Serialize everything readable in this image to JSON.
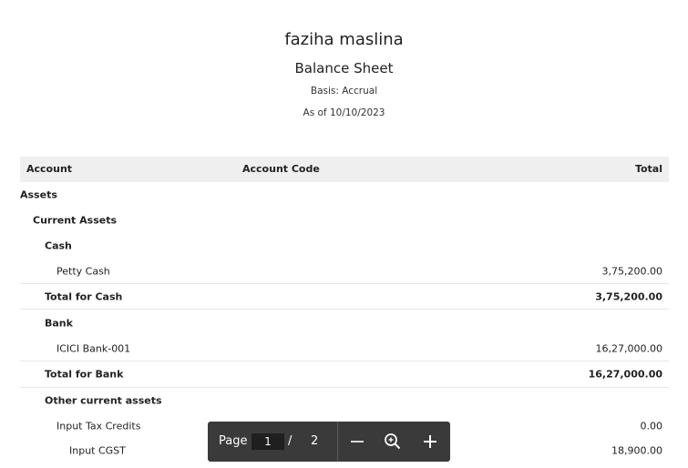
{
  "header": {
    "org_name": "faziha maslina",
    "report_title": "Balance Sheet",
    "basis": "Basis: Accrual",
    "as_of": "As of 10/10/2023"
  },
  "table": {
    "columns": {
      "account": "Account",
      "code": "Account Code",
      "total": "Total"
    },
    "rows": [
      {
        "label": "Assets",
        "amount": ""
      },
      {
        "label": "Current Assets",
        "amount": ""
      },
      {
        "label": "Cash",
        "amount": ""
      },
      {
        "label": "Petty Cash",
        "amount": "3,75,200.00"
      },
      {
        "label": "Total for Cash",
        "amount": "3,75,200.00"
      },
      {
        "label": "Bank",
        "amount": ""
      },
      {
        "label": "ICICI Bank-001",
        "amount": "16,27,000.00"
      },
      {
        "label": "Total for Bank",
        "amount": "16,27,000.00"
      },
      {
        "label": "Other current assets",
        "amount": ""
      },
      {
        "label": "Input Tax Credits",
        "amount": "0.00"
      },
      {
        "label": "Input CGST",
        "amount": "18,900.00"
      }
    ]
  },
  "viewer": {
    "page_label": "Page",
    "current_page": "1",
    "separator": "/",
    "total_pages": "2",
    "icons": {
      "zoom_out": "minus-icon",
      "zoom_fit": "zoom-magnifier-icon",
      "zoom_in": "plus-icon"
    }
  }
}
